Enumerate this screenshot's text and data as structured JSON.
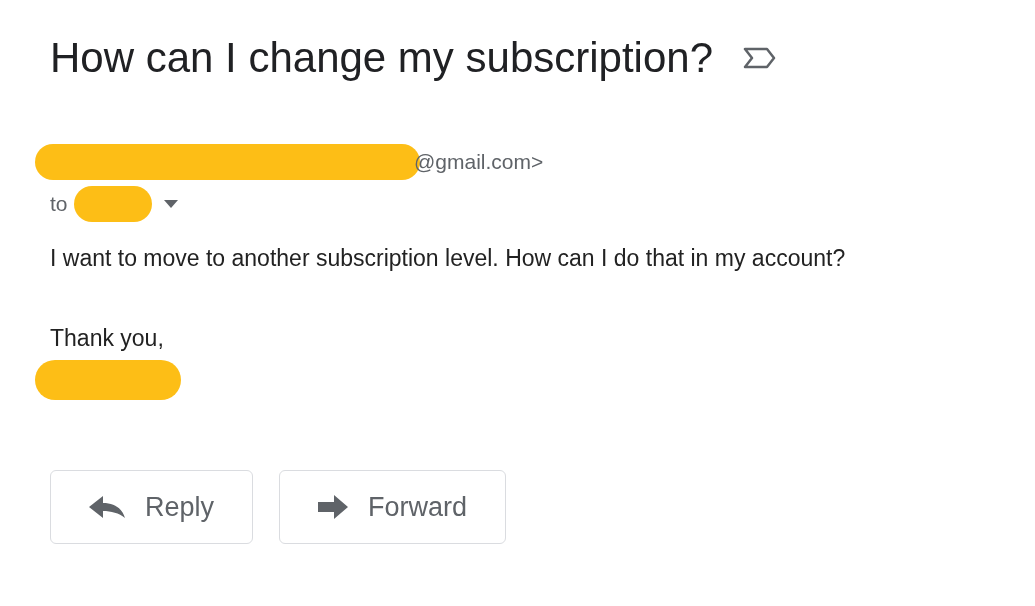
{
  "subject": "How can I change my subscription?",
  "sender": {
    "email_tail": "@gmail.com>"
  },
  "recipient": {
    "label": "to"
  },
  "body": [
    "I want to move to another subscription level. How can I do that in my account?",
    "Thank you,"
  ],
  "buttons": [
    {
      "label": "Reply",
      "kind": "reply"
    },
    {
      "label": "Forward",
      "kind": "forward"
    }
  ]
}
